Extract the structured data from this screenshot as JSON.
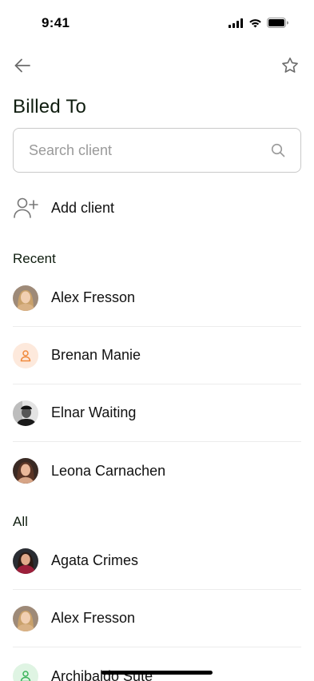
{
  "status_bar": {
    "time": "9:41"
  },
  "header": {
    "title": "Billed To",
    "back_icon": "arrow-left-icon",
    "favorite_icon": "star-icon"
  },
  "search": {
    "placeholder": "Search client",
    "value": "",
    "icon": "search-icon"
  },
  "add_client": {
    "label": "Add client",
    "icon": "add-user-icon"
  },
  "recent": {
    "title": "Recent",
    "items": [
      {
        "name": "Alex Fresson",
        "avatar": "photo"
      },
      {
        "name": "Brenan Manie",
        "avatar": "placeholder-orange"
      },
      {
        "name": "Elnar Waiting",
        "avatar": "photo"
      },
      {
        "name": "Leona Carnachen",
        "avatar": "photo"
      }
    ]
  },
  "all": {
    "title": "All",
    "items": [
      {
        "name": "Agata Crimes",
        "avatar": "photo"
      },
      {
        "name": "Alex Fresson",
        "avatar": "photo"
      },
      {
        "name": "Archibaldo Sute",
        "avatar": "placeholder-green"
      }
    ]
  },
  "colors": {
    "orange_accent": "#f08a3c",
    "green_accent": "#3cb45a",
    "title": "#0f1d0f"
  }
}
